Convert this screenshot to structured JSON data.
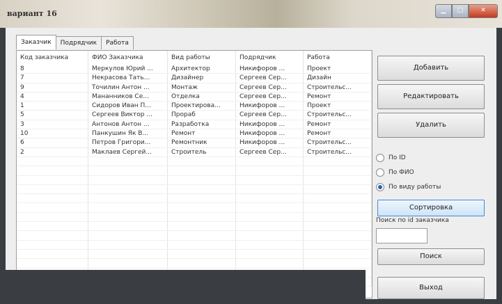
{
  "window": {
    "title": "вариант 16"
  },
  "tabs": [
    {
      "label": "Заказчик",
      "active": true
    },
    {
      "label": "Подрядчик",
      "active": false
    },
    {
      "label": "Работа",
      "active": false
    }
  ],
  "table": {
    "columns": [
      "Код заказчика",
      "ФИО Заказчика",
      "Вид работы",
      "Подрядчик",
      "Работа"
    ],
    "rows": [
      [
        "8",
        "Меркулов Юрий ...",
        "Архитектор",
        "Никифоров ...",
        "Проект"
      ],
      [
        "7",
        "Некрасова Тать...",
        "Дизайнер",
        "Сергеев Сер...",
        "Дизайн"
      ],
      [
        "9",
        "Точилин Антон ...",
        "Монтаж",
        "Сергеев Сер...",
        "Строительс..."
      ],
      [
        "4",
        "Мананников Се...",
        "Отделка",
        "Сергеев Сер...",
        "Ремонт"
      ],
      [
        "1",
        "Сидоров Иван П...",
        "Проектирова...",
        "Никифоров ...",
        "Проект"
      ],
      [
        "5",
        "Сергеев Виктор ...",
        "Прораб",
        "Сергеев Сер...",
        "Строительс..."
      ],
      [
        "3",
        "Антонов Антон ...",
        "Разработка",
        "Никифоров ...",
        "Ремонт"
      ],
      [
        "10",
        "Панкушин Як В...",
        "Ремонт",
        "Никифоров ...",
        "Ремонт"
      ],
      [
        "6",
        "Петров Григори...",
        "Ремонтник",
        "Никифоров ...",
        "Строительс..."
      ],
      [
        "2",
        "Маклаев Сергей...",
        "Строитель",
        "Сергеев Сер...",
        "Строительс..."
      ]
    ]
  },
  "actions": {
    "add": "Добавить",
    "edit": "Редактировать",
    "delete": "Удалить"
  },
  "sort_options": [
    {
      "label": "По ID",
      "selected": false
    },
    {
      "label": "По ФИО",
      "selected": false
    },
    {
      "label": "По виду работы",
      "selected": true
    }
  ],
  "sort_button": "Сортировка",
  "search": {
    "label": "Поиск по id заказчика",
    "value": "",
    "button": "Поиск"
  },
  "exit_button": "Выход"
}
